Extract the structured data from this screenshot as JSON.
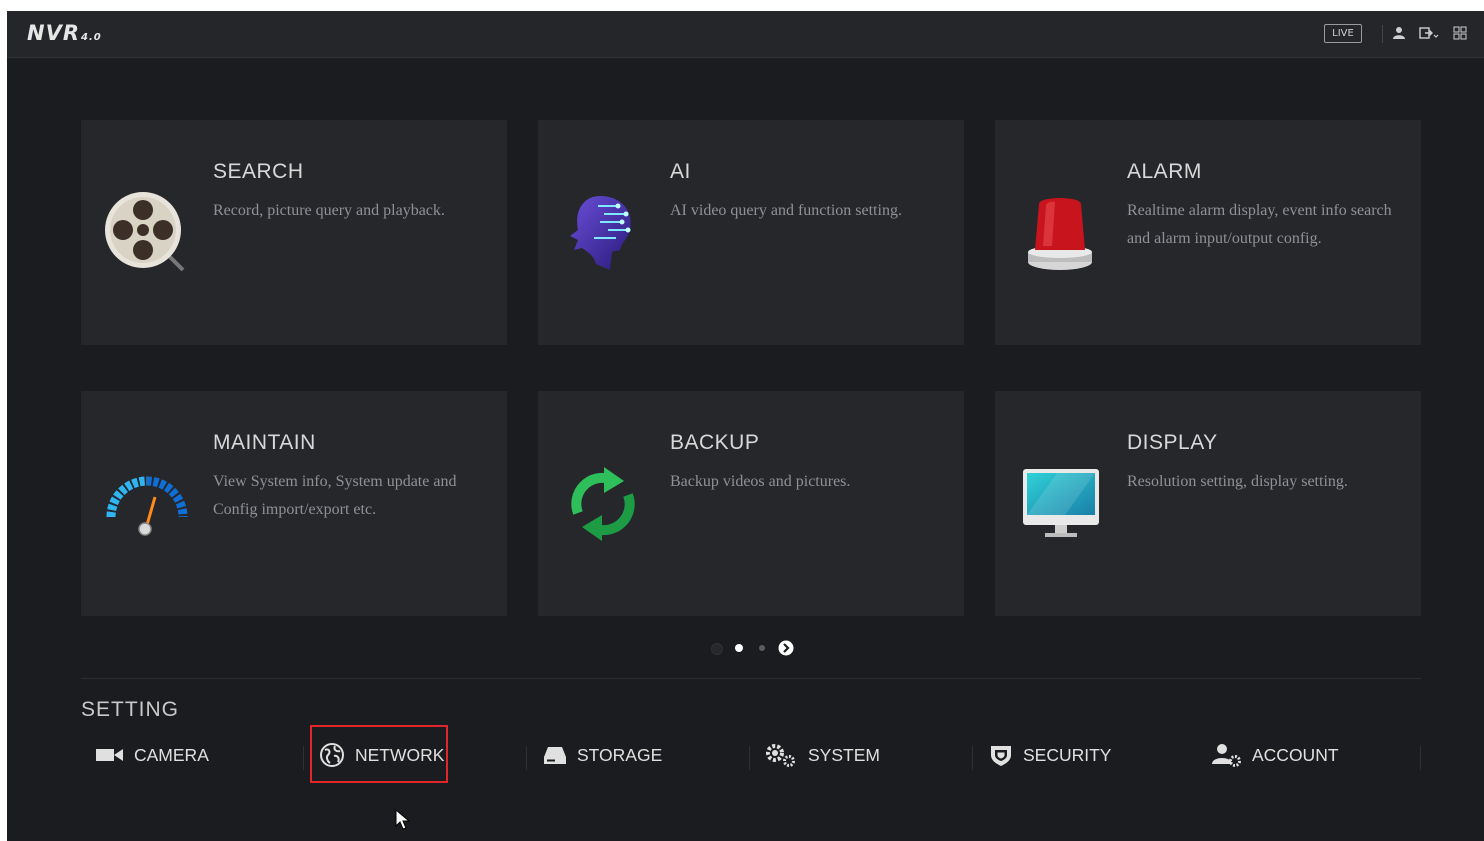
{
  "app": {
    "logo": "NVR",
    "logo_version": "4.0"
  },
  "topbar": {
    "live_label": "LIVE",
    "icons": [
      "user-icon",
      "logout-icon",
      "layout-icon"
    ]
  },
  "cards": [
    {
      "title": "SEARCH",
      "desc": "Record, picture query and playback.",
      "icon": "film-reel-icon"
    },
    {
      "title": "AI",
      "desc": "AI video query and function setting.",
      "icon": "ai-head-icon"
    },
    {
      "title": "ALARM",
      "desc": "Realtime alarm display, event info search and alarm input/output config.",
      "icon": "alarm-siren-icon"
    },
    {
      "title": "MAINTAIN",
      "desc": "View System info, System update and Config import/export etc.",
      "icon": "gauge-icon"
    },
    {
      "title": "BACKUP",
      "desc": "Backup videos and pictures.",
      "icon": "refresh-arrows-icon"
    },
    {
      "title": "DISPLAY",
      "desc": "Resolution setting, display setting.",
      "icon": "monitor-icon"
    }
  ],
  "pager": {
    "pages": 3,
    "current": 1
  },
  "setting": {
    "title": "SETTING",
    "items": [
      {
        "label": "CAMERA",
        "icon": "camera-icon"
      },
      {
        "label": "NETWORK",
        "icon": "globe-icon",
        "highlighted": true
      },
      {
        "label": "STORAGE",
        "icon": "hard-drive-icon"
      },
      {
        "label": "SYSTEM",
        "icon": "gears-icon"
      },
      {
        "label": "SECURITY",
        "icon": "shield-icon"
      },
      {
        "label": "ACCOUNT",
        "icon": "user-gear-icon"
      }
    ]
  },
  "colors": {
    "background": "#1b1c1f",
    "card": "#26272b",
    "highlight": "#e0262a",
    "backup_green": "#2fbf5a"
  }
}
